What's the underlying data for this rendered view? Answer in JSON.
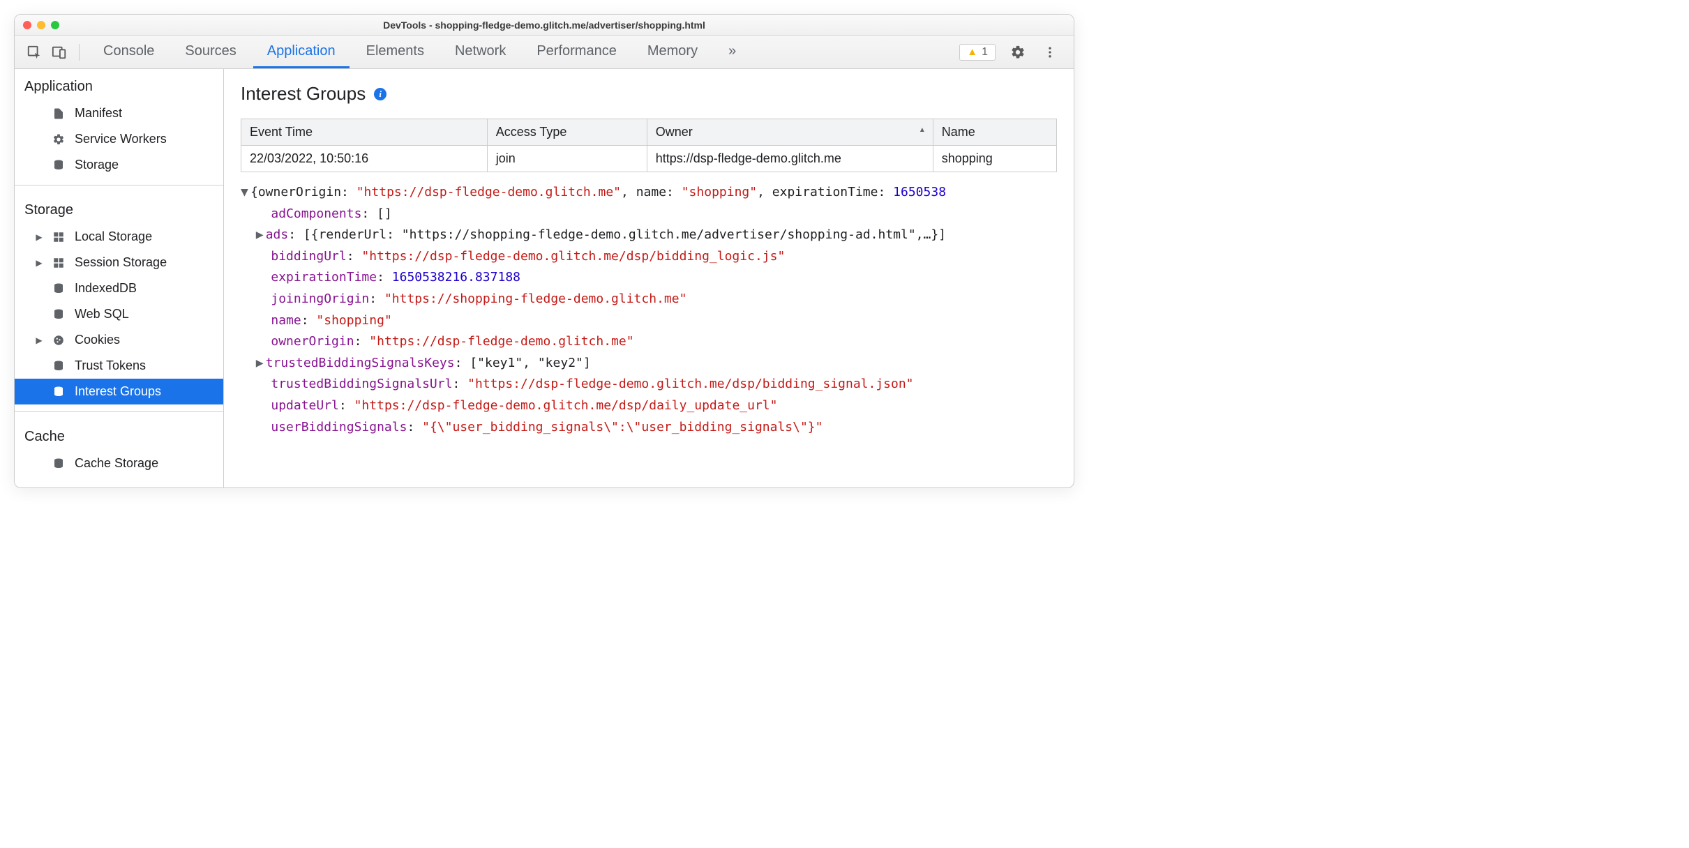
{
  "window_title": "DevTools - shopping-fledge-demo.glitch.me/advertiser/shopping.html",
  "tabs": [
    "Console",
    "Sources",
    "Application",
    "Elements",
    "Network",
    "Performance",
    "Memory"
  ],
  "warn_count": "1",
  "sidebar": {
    "sections": {
      "application": "Application",
      "storage": "Storage",
      "cache": "Cache"
    },
    "app_items": {
      "manifest": "Manifest",
      "service_workers": "Service Workers",
      "storage": "Storage"
    },
    "storage_items": {
      "local_storage": "Local Storage",
      "session_storage": "Session Storage",
      "indexeddb": "IndexedDB",
      "web_sql": "Web SQL",
      "cookies": "Cookies",
      "trust_tokens": "Trust Tokens",
      "interest_groups": "Interest Groups"
    },
    "cache_items": {
      "cache_storage": "Cache Storage"
    }
  },
  "content": {
    "heading": "Interest Groups",
    "headers": {
      "event_time": "Event Time",
      "access_type": "Access Type",
      "owner": "Owner",
      "name": "Name"
    },
    "row": {
      "event_time": "22/03/2022, 10:50:16",
      "access_type": "join",
      "owner": "https://dsp-fledge-demo.glitch.me",
      "name": "shopping"
    }
  },
  "json": {
    "top_line_prefix": "{ownerOrigin: ",
    "ownerOrigin": "\"https://dsp-fledge-demo.glitch.me\"",
    "top_name_label": ", name: ",
    "top_name_val": "\"shopping\"",
    "top_exp_label": ", expirationTime: ",
    "top_exp_val": "1650538",
    "adComponents_label": "adComponents",
    "adComponents_val": "[]",
    "ads_label": "ads",
    "ads_val": "[{renderUrl: \"https://shopping-fledge-demo.glitch.me/advertiser/shopping-ad.html\",…}]",
    "biddingUrl_label": "biddingUrl",
    "biddingUrl_val": "\"https://dsp-fledge-demo.glitch.me/dsp/bidding_logic.js\"",
    "expirationTime_label": "expirationTime",
    "expirationTime_val": "1650538216.837188",
    "joiningOrigin_label": "joiningOrigin",
    "joiningOrigin_val": "\"https://shopping-fledge-demo.glitch.me\"",
    "name_label": "name",
    "name_val": "\"shopping\"",
    "ownerOrigin_label": "ownerOrigin",
    "ownerOrigin_val": "\"https://dsp-fledge-demo.glitch.me\"",
    "tbsk_label": "trustedBiddingSignalsKeys",
    "tbsk_val": "[\"key1\", \"key2\"]",
    "tbsu_label": "trustedBiddingSignalsUrl",
    "tbsu_val": "\"https://dsp-fledge-demo.glitch.me/dsp/bidding_signal.json\"",
    "updateUrl_label": "updateUrl",
    "updateUrl_val": "\"https://dsp-fledge-demo.glitch.me/dsp/daily_update_url\"",
    "userBiddingSignals_label": "userBiddingSignals",
    "userBiddingSignals_val": "\"{\\\"user_bidding_signals\\\":\\\"user_bidding_signals\\\"}\""
  }
}
